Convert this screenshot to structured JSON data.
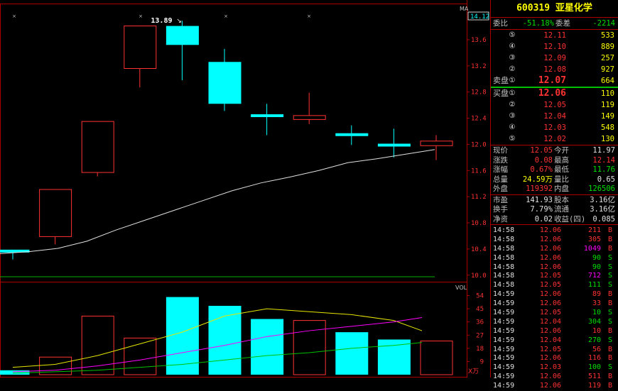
{
  "stock": {
    "code": "600319",
    "name": "亚星化学",
    "title": "600319  亚星化学"
  },
  "chart": {
    "ma_label": "MA",
    "ma_value": "14.12",
    "high_label": "13.89",
    "vol_label": "VOL",
    "x_unit": "X万",
    "price_ticks": [
      "13.6",
      "13.2",
      "12.8",
      "12.4",
      "12.0",
      "11.6",
      "11.2",
      "10.8",
      "10.4",
      "10.0"
    ],
    "vol_ticks": [
      "54",
      "45",
      "36",
      "27",
      "18",
      "9"
    ]
  },
  "chart_data": {
    "type": "candlestick",
    "price_ylim": [
      9.9,
      14.12
    ],
    "candles": [
      {
        "open": 10.36,
        "close": 10.39,
        "high": 10.39,
        "low": 10.24,
        "color": "cyan"
      },
      {
        "open": 10.59,
        "close": 11.31,
        "high": 11.31,
        "low": 10.47,
        "color": "red"
      },
      {
        "open": 11.57,
        "close": 12.35,
        "high": 12.35,
        "low": 11.51,
        "color": "red"
      },
      {
        "open": 13.16,
        "close": 13.81,
        "high": 13.81,
        "low": 12.87,
        "color": "red"
      },
      {
        "open": 13.81,
        "close": 13.52,
        "high": 13.89,
        "low": 12.98,
        "color": "cyan"
      },
      {
        "open": 13.26,
        "close": 12.62,
        "high": 13.46,
        "low": 12.51,
        "color": "cyan"
      },
      {
        "open": 12.46,
        "close": 12.43,
        "high": 12.62,
        "low": 12.14,
        "color": "cyan"
      },
      {
        "open": 12.44,
        "close": 12.38,
        "high": 12.79,
        "low": 12.31,
        "color": "red"
      },
      {
        "open": 12.17,
        "close": 12.13,
        "high": 12.29,
        "low": 11.99,
        "color": "cyan"
      },
      {
        "open": 12.01,
        "close": 11.98,
        "high": 12.24,
        "low": 11.8,
        "color": "cyan"
      },
      {
        "open": 12.05,
        "close": 11.98,
        "high": 12.14,
        "low": 11.76,
        "color": "red"
      }
    ],
    "ma_line": [
      10.33,
      10.36,
      10.41,
      10.52,
      10.69,
      10.84,
      10.99,
      11.14,
      11.29,
      11.41,
      11.5,
      11.6,
      11.72,
      11.78,
      11.85,
      11.92
    ],
    "volume": {
      "ylim": [
        0,
        62
      ],
      "bars": [
        {
          "value": 3,
          "color": "cyan"
        },
        {
          "value": 12,
          "color": "red"
        },
        {
          "value": 40,
          "color": "red"
        },
        {
          "value": 25,
          "color": "red"
        },
        {
          "value": 53,
          "color": "cyan"
        },
        {
          "value": 47,
          "color": "cyan"
        },
        {
          "value": 38,
          "color": "cyan"
        },
        {
          "value": 37,
          "color": "red"
        },
        {
          "value": 29,
          "color": "cyan"
        },
        {
          "value": 24,
          "color": "cyan"
        },
        {
          "value": 23,
          "color": "red"
        }
      ],
      "ma5": [
        5,
        7,
        13,
        21,
        29,
        40,
        45,
        43,
        41,
        37,
        30
      ],
      "ma10": [
        2,
        3,
        6,
        10,
        15,
        20,
        26,
        30,
        33,
        36,
        39
      ],
      "ma20": [
        1,
        2,
        3,
        5,
        7,
        10,
        13,
        15,
        18,
        20,
        22
      ]
    }
  },
  "weibi": {
    "label1": "委比",
    "value1": "-51.18%",
    "label2": "委差",
    "value2": "-2214"
  },
  "sell": [
    {
      "lvl": "⑤",
      "price": "12.11",
      "vol": "533"
    },
    {
      "lvl": "④",
      "price": "12.10",
      "vol": "889"
    },
    {
      "lvl": "③",
      "price": "12.09",
      "vol": "257"
    },
    {
      "lvl": "②",
      "price": "12.08",
      "vol": "927"
    },
    {
      "lvl": "①",
      "price": "12.07",
      "vol": "664"
    }
  ],
  "buy": [
    {
      "lvl": "①",
      "price": "12.06",
      "vol": "110"
    },
    {
      "lvl": "②",
      "price": "12.05",
      "vol": "119"
    },
    {
      "lvl": "③",
      "price": "12.04",
      "vol": "149"
    },
    {
      "lvl": "④",
      "price": "12.03",
      "vol": "548"
    },
    {
      "lvl": "⑤",
      "price": "12.02",
      "vol": "130"
    }
  ],
  "sell_label": "卖盘",
  "buy_label": "买盘",
  "quote": [
    {
      "l1": "现价",
      "v1": "12.05",
      "c1": "r",
      "l2": "今开",
      "v2": "11.97",
      "c2": "w"
    },
    {
      "l1": "涨跌",
      "v1": "0.08",
      "c1": "r",
      "l2": "最高",
      "v2": "12.14",
      "c2": "r"
    },
    {
      "l1": "涨幅",
      "v1": "0.67%",
      "c1": "r",
      "l2": "最低",
      "v2": "11.76",
      "c2": "g"
    },
    {
      "l1": "总量",
      "v1": "24.59万",
      "c1": "y",
      "l2": "量比",
      "v2": "0.65",
      "c2": "w"
    },
    {
      "l1": "外盘",
      "v1": "119392",
      "c1": "r",
      "l2": "内盘",
      "v2": "126506",
      "c2": "g"
    }
  ],
  "fund": [
    {
      "l1": "市盈",
      "v1": "141.93",
      "l2": "股本",
      "v2": "3.16亿"
    },
    {
      "l1": "换手",
      "v1": "7.79%",
      "l2": "流通",
      "v2": "3.16亿"
    },
    {
      "l1": "净资",
      "v1": "0.02",
      "l2": "收益(四)",
      "v2": "0.085"
    }
  ],
  "trades": [
    {
      "t": "14:58",
      "p": "12.06",
      "v": "211",
      "s": "B",
      "vc": "r"
    },
    {
      "t": "14:58",
      "p": "12.06",
      "v": "305",
      "s": "B",
      "vc": "r"
    },
    {
      "t": "14:58",
      "p": "12.06",
      "v": "1049",
      "s": "B",
      "vc": "m"
    },
    {
      "t": "14:58",
      "p": "12.06",
      "v": "90",
      "s": "S",
      "vc": "g"
    },
    {
      "t": "14:58",
      "p": "12.06",
      "v": "90",
      "s": "S",
      "vc": "g"
    },
    {
      "t": "14:58",
      "p": "12.05",
      "v": "712",
      "s": "S",
      "vc": "m"
    },
    {
      "t": "14:58",
      "p": "12.05",
      "v": "111",
      "s": "S",
      "vc": "g"
    },
    {
      "t": "14:59",
      "p": "12.06",
      "v": "89",
      "s": "B",
      "vc": "r"
    },
    {
      "t": "14:59",
      "p": "12.06",
      "v": "33",
      "s": "B",
      "vc": "r"
    },
    {
      "t": "14:59",
      "p": "12.05",
      "v": "10",
      "s": "S",
      "vc": "g"
    },
    {
      "t": "14:59",
      "p": "12.04",
      "v": "304",
      "s": "S",
      "vc": "g"
    },
    {
      "t": "14:59",
      "p": "12.06",
      "v": "10",
      "s": "B",
      "vc": "r"
    },
    {
      "t": "14:59",
      "p": "12.04",
      "v": "270",
      "s": "S",
      "vc": "g"
    },
    {
      "t": "14:59",
      "p": "12.05",
      "v": "56",
      "s": "B",
      "vc": "r"
    },
    {
      "t": "14:59",
      "p": "12.06",
      "v": "116",
      "s": "B",
      "vc": "r"
    },
    {
      "t": "14:59",
      "p": "12.03",
      "v": "100",
      "s": "S",
      "vc": "g"
    },
    {
      "t": "14:59",
      "p": "12.06",
      "v": "511",
      "s": "B",
      "vc": "r"
    },
    {
      "t": "14:59",
      "p": "12.06",
      "v": "119",
      "s": "B",
      "vc": "r"
    }
  ],
  "colors": {
    "up": "#ff3232",
    "down": "#00ffff",
    "ma": "#e0e0e0",
    "border": "#aa0000"
  }
}
